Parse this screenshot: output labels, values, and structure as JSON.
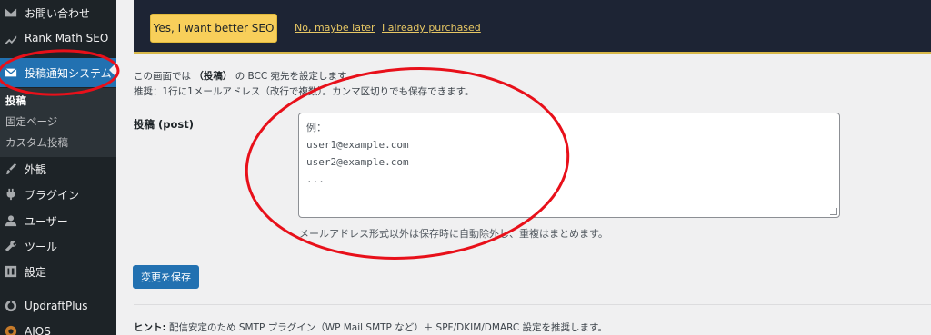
{
  "sidebar": {
    "items": [
      {
        "label": "お問い合わせ",
        "icon": "envelope-icon"
      },
      {
        "label": "Rank Math SEO",
        "icon": "chart-icon"
      },
      {
        "label": "投稿通知システム",
        "icon": "envelope-icon"
      },
      {
        "label": "外観",
        "icon": "brush-icon"
      },
      {
        "label": "プラグイン",
        "icon": "plug-icon"
      },
      {
        "label": "ユーザー",
        "icon": "user-icon"
      },
      {
        "label": "ツール",
        "icon": "wrench-icon"
      },
      {
        "label": "設定",
        "icon": "settings-icon"
      },
      {
        "label": "UpdraftPlus",
        "icon": "updraft-icon"
      },
      {
        "label": "AIOS",
        "icon": "shield-icon"
      }
    ],
    "submenu": [
      "投稿",
      "固定ページ",
      "カスタム投稿"
    ]
  },
  "notice": {
    "primary_button": "Yes, I want better SEO",
    "link_later": "No, maybe later",
    "link_purchased": "I already purchased"
  },
  "content": {
    "desc_prefix": "この画面では",
    "desc_bold": "（投稿）",
    "desc_suffix": "の BCC 宛先を設定します。",
    "recommend": "推奨：1行に1メールアドレス（改行で複数）。カンマ区切りでも保存できます。",
    "field_label": "投稿 (post)",
    "textarea_lines": [
      "例：",
      "user1@example.com",
      "user2@example.com",
      "..."
    ],
    "help_text": "メールアドレス形式以外は保存時に自動除外し、重複はまとめます。",
    "save_button": "変更を保存",
    "hint_label": "ヒント:",
    "hint_text": "配信安定のため SMTP プラグイン（WP Mail SMTP など）＋ SPF/DKIM/DMARC 設定を推奨します。"
  },
  "colors": {
    "sidebar_bg": "#1d2327",
    "active_bg": "#2271b1",
    "notice_bg": "#1d2434",
    "notice_button": "#f8cf5a",
    "annotation": "#e8101a"
  }
}
